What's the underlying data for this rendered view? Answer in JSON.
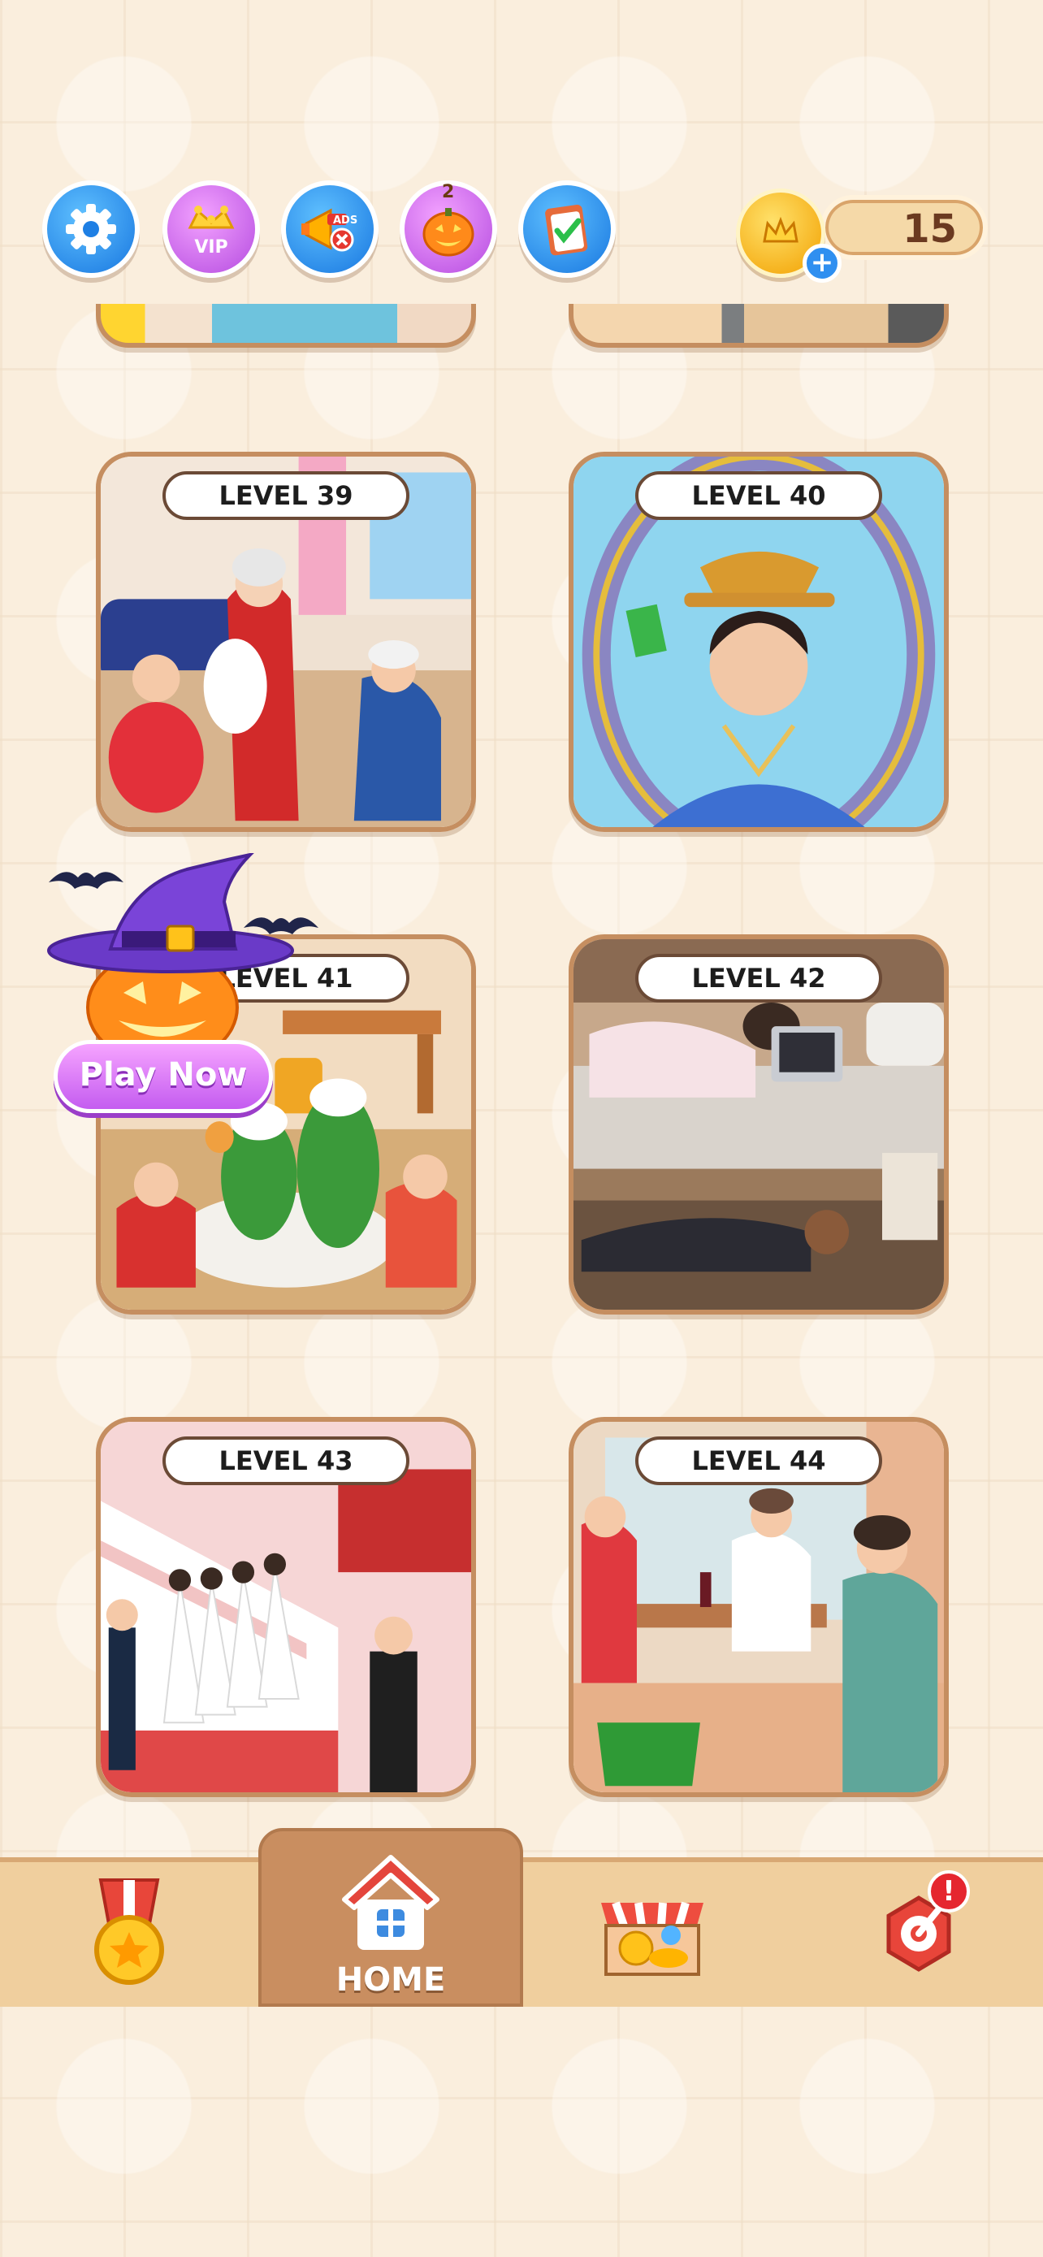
{
  "header": {
    "buttons": [
      {
        "name": "settings-button",
        "icon": "gear-icon"
      },
      {
        "name": "vip-button",
        "icon": "crown-icon",
        "label": "VIP"
      },
      {
        "name": "remove-ads-button",
        "icon": "megaphone-no-ads-icon",
        "label": "ADS"
      },
      {
        "name": "halloween-event-button",
        "icon": "jack-o-lantern-icon",
        "badge": "2"
      },
      {
        "name": "tasks-button",
        "icon": "clipboard-check-icon"
      }
    ],
    "coins": {
      "count": "15",
      "icon": "crown-coin-icon",
      "add_icon": "plus-icon"
    }
  },
  "levels": [
    {
      "label": "LEVEL 39"
    },
    {
      "label": "LEVEL 40"
    },
    {
      "label": "LEVEL 41"
    },
    {
      "label": "LEVEL 42"
    },
    {
      "label": "LEVEL 43"
    },
    {
      "label": "LEVEL 44"
    }
  ],
  "promo": {
    "button_label": "Play Now",
    "icon": "witch-hat-pumpkin-icon"
  },
  "nav": {
    "items": [
      {
        "name": "achievements",
        "icon": "medal-icon"
      },
      {
        "name": "home",
        "icon": "house-icon",
        "label": "HOME",
        "active": true
      },
      {
        "name": "shop",
        "icon": "shop-icon"
      },
      {
        "name": "spin",
        "icon": "lucky-wheel-icon",
        "badge": "!"
      }
    ]
  },
  "colors": {
    "background": "#faeedd",
    "card_border": "#c58e60",
    "nav_bar": "#f0cf9e",
    "nav_active": "#c98e60",
    "accent_blue": "#1877e0",
    "accent_purple": "#b54ce0"
  }
}
